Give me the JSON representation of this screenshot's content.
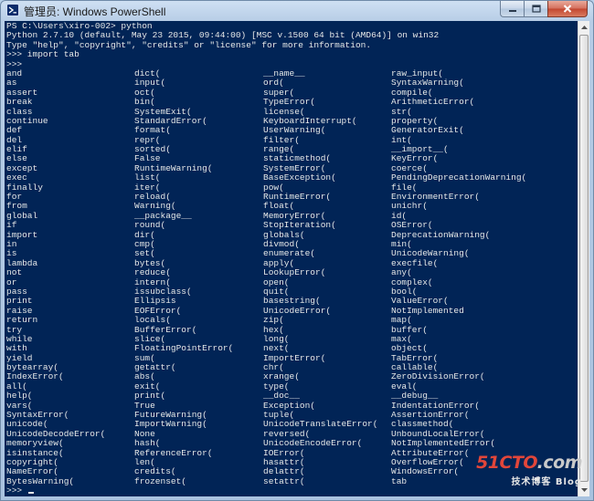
{
  "window": {
    "title": "管理员: Windows PowerShell",
    "icon": "powershell-icon",
    "caption_buttons": {
      "minimize": "minimize-icon",
      "maximize": "maximize-icon",
      "close": "close-icon"
    }
  },
  "colors": {
    "console_background": "#012456",
    "console_text": "#e8e8e8",
    "titlebar": "#b9d1ea"
  },
  "console": {
    "header_lines": [
      "PS C:\\Users\\xiro-002> python",
      "Python 2.7.10 (default, May 23 2015, 09:44:00) [MSC v.1500 64 bit (AMD64)] on win32",
      "Type \"help\", \"copyright\", \"credits\" or \"license\" for more information.",
      ">>> import tab",
      ">>>"
    ],
    "completion_rows": [
      [
        "and",
        "dict(",
        "__name__",
        "raw_input("
      ],
      [
        "as",
        "input(",
        "ord(",
        "SyntaxWarning("
      ],
      [
        "assert",
        "oct(",
        "super(",
        "compile("
      ],
      [
        "break",
        "bin(",
        "TypeError(",
        "ArithmeticError("
      ],
      [
        "class",
        "SystemExit(",
        "license(",
        "str("
      ],
      [
        "continue",
        "StandardError(",
        "KeyboardInterrupt(",
        "property("
      ],
      [
        "def",
        "format(",
        "UserWarning(",
        "GeneratorExit("
      ],
      [
        "del",
        "repr(",
        "filter(",
        "int("
      ],
      [
        "elif",
        "sorted(",
        "range(",
        "__import__("
      ],
      [
        "else",
        "False",
        "staticmethod(",
        "KeyError("
      ],
      [
        "except",
        "RuntimeWarning(",
        "SystemError(",
        "coerce("
      ],
      [
        "exec",
        "list(",
        "BaseException(",
        "PendingDeprecationWarning("
      ],
      [
        "finally",
        "iter(",
        "pow(",
        "file("
      ],
      [
        "for",
        "reload(",
        "RuntimeError(",
        "EnvironmentError("
      ],
      [
        "from",
        "Warning(",
        "float(",
        "unichr("
      ],
      [
        "global",
        "__package__",
        "MemoryError(",
        "id("
      ],
      [
        "if",
        "round(",
        "StopIteration(",
        "OSError("
      ],
      [
        "import",
        "dir(",
        "globals(",
        "DeprecationWarning("
      ],
      [
        "in",
        "cmp(",
        "divmod(",
        "min("
      ],
      [
        "is",
        "set(",
        "enumerate(",
        "UnicodeWarning("
      ],
      [
        "lambda",
        "bytes(",
        "apply(",
        "execfile("
      ],
      [
        "not",
        "reduce(",
        "LookupError(",
        "any("
      ],
      [
        "or",
        "intern(",
        "open(",
        "complex("
      ],
      [
        "pass",
        "issubclass(",
        "quit(",
        "bool("
      ],
      [
        "print",
        "Ellipsis",
        "basestring(",
        "ValueError("
      ],
      [
        "raise",
        "EOFError(",
        "UnicodeError(",
        "NotImplemented"
      ],
      [
        "return",
        "locals(",
        "zip(",
        "map("
      ],
      [
        "try",
        "BufferError(",
        "hex(",
        "buffer("
      ],
      [
        "while",
        "slice(",
        "long(",
        "max("
      ],
      [
        "with",
        "FloatingPointError(",
        "next(",
        "object("
      ],
      [
        "yield",
        "sum(",
        "ImportError(",
        "TabError("
      ],
      [
        "bytearray(",
        "getattr(",
        "chr(",
        "callable("
      ],
      [
        "IndexError(",
        "abs(",
        "xrange(",
        "ZeroDivisionError("
      ],
      [
        "all(",
        "exit(",
        "type(",
        "eval("
      ],
      [
        "help(",
        "print(",
        "__doc__",
        "__debug__"
      ],
      [
        "vars(",
        "True",
        "Exception(",
        "IndentationError("
      ],
      [
        "SyntaxError(",
        "FutureWarning(",
        "tuple(",
        "AssertionError("
      ],
      [
        "unicode(",
        "ImportWarning(",
        "UnicodeTranslateError(",
        "classmethod("
      ],
      [
        "UnicodeDecodeError(",
        "None",
        "reversed(",
        "UnboundLocalError("
      ],
      [
        "memoryview(",
        "hash(",
        "UnicodeEncodeError(",
        "NotImplementedError("
      ],
      [
        "isinstance(",
        "ReferenceError(",
        "IOError(",
        "AttributeError("
      ],
      [
        "copyright(",
        "len(",
        "hasattr(",
        "OverflowError("
      ],
      [
        "NameError(",
        "credits(",
        "delattr(",
        "WindowsError("
      ],
      [
        "BytesWarning(",
        "frozenset(",
        "setattr(",
        "tab"
      ]
    ],
    "prompt": ">>>"
  },
  "watermark": {
    "brand_prefix": "51CTO",
    "brand_suffix": ".com",
    "subtitle": "技术博客",
    "tag": "Blog"
  }
}
